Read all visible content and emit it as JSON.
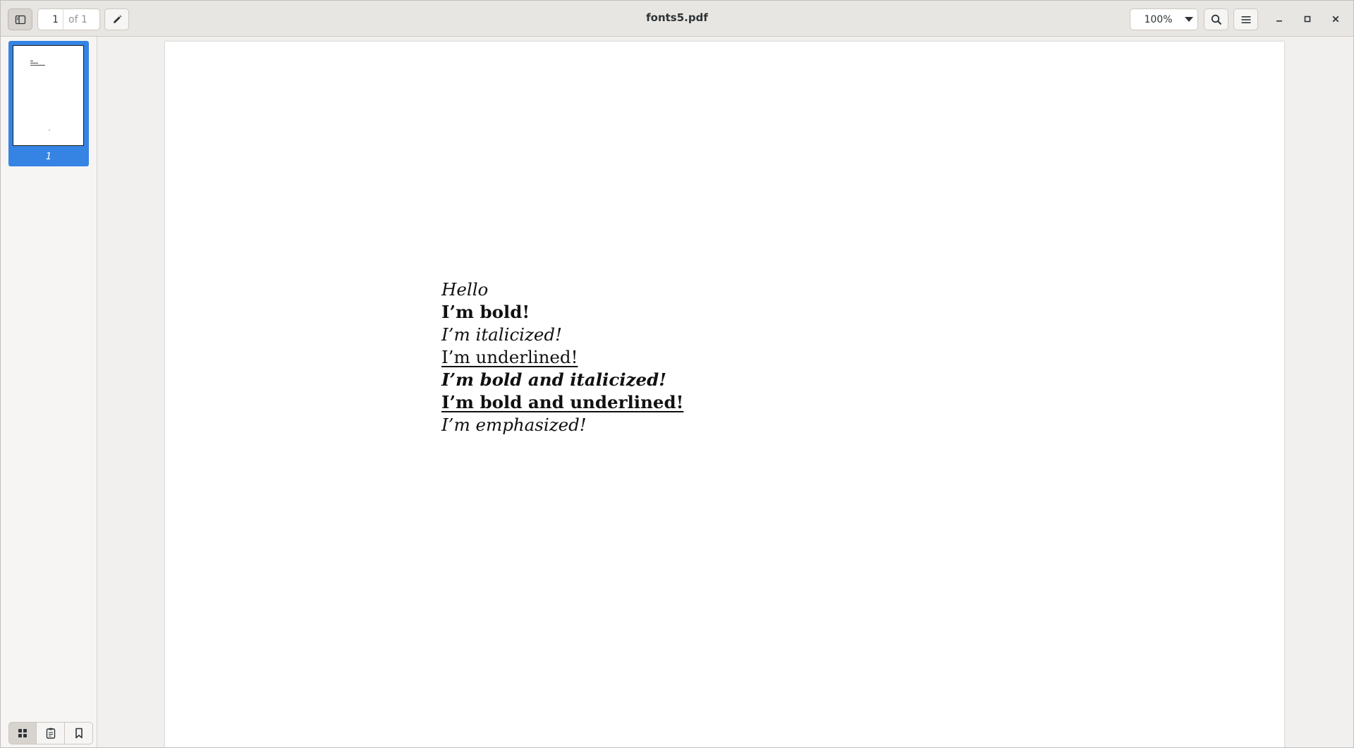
{
  "header": {
    "title": "fonts5.pdf",
    "page_current": "1",
    "page_total": "of 1",
    "zoom": "100%"
  },
  "sidebar": {
    "thumbnails": [
      {
        "label": "1"
      }
    ],
    "tabs": [
      {
        "name": "thumbnails",
        "icon": "grid-icon",
        "active": true
      },
      {
        "name": "outline",
        "icon": "document-icon",
        "active": false
      },
      {
        "name": "bookmarks",
        "icon": "bookmark-icon",
        "active": false
      }
    ]
  },
  "document": {
    "lines": [
      "Hello",
      "I’m bold!",
      "I’m italicized!",
      "I’m underlined!",
      "I’m bold and italicized!",
      "I’m bold and underlined!",
      "I’m emphasized!"
    ]
  },
  "colors": {
    "accent": "#3584e4",
    "header_bg": "#e8e6e3",
    "canvas_bg": "#f1f0ee"
  }
}
